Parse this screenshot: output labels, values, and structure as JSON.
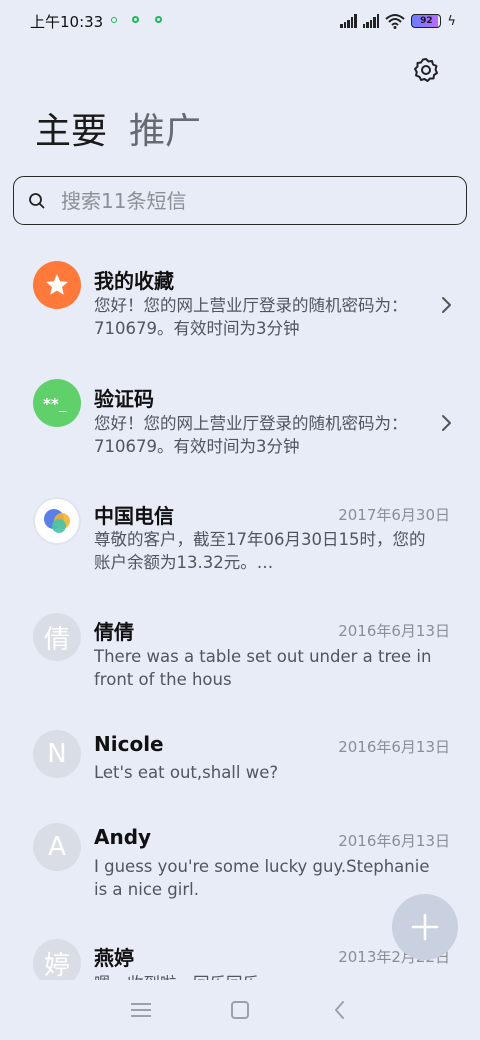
{
  "status_bar": {
    "time": "上午10:33",
    "battery_level": "92"
  },
  "tabs": {
    "primary": "主要",
    "promo": "推广"
  },
  "search": {
    "placeholder": "搜索11条短信"
  },
  "conversations": [
    {
      "title": "我的收藏",
      "date": "",
      "body": "您好！您的网上营业厅登录的随机密码为：710679。有效时间为3分钟",
      "avatar": "star-icon"
    },
    {
      "title": "验证码",
      "date": "",
      "body": "您好！您的网上营业厅登录的随机密码为：710679。有效时间为3分钟",
      "avatar": "asterisk-code-icon"
    },
    {
      "title": "中国电信",
      "date": "2017年6月30日",
      "body": "尊敬的客户，截至17年06月30日15时，您的账户余额为13.32元。…",
      "avatar": "telecom-logo-icon"
    },
    {
      "title": "倩倩",
      "date": "2016年6月13日",
      "body": "There was a table set out under a tree in front of the hous",
      "avatar_letter": "倩"
    },
    {
      "title": "Nicole",
      "date": "2016年6月13日",
      "body": "Let's eat out,shall we?",
      "avatar_letter": "N"
    },
    {
      "title": "Andy",
      "date": "2016年6月13日",
      "body": "I guess you're some lucky guy.Stephanie is a nice girl.",
      "avatar_letter": "A"
    },
    {
      "title": "燕婷",
      "date": "2013年2月22日",
      "body": "嗯，收到啦，回乐回乐",
      "avatar_letter": "婷"
    }
  ],
  "colors": {
    "background": "#e7ecf7",
    "favorites_avatar": "#ff7a3a",
    "verification_avatar": "#5fd06a",
    "fab": "#c9d0e0"
  }
}
